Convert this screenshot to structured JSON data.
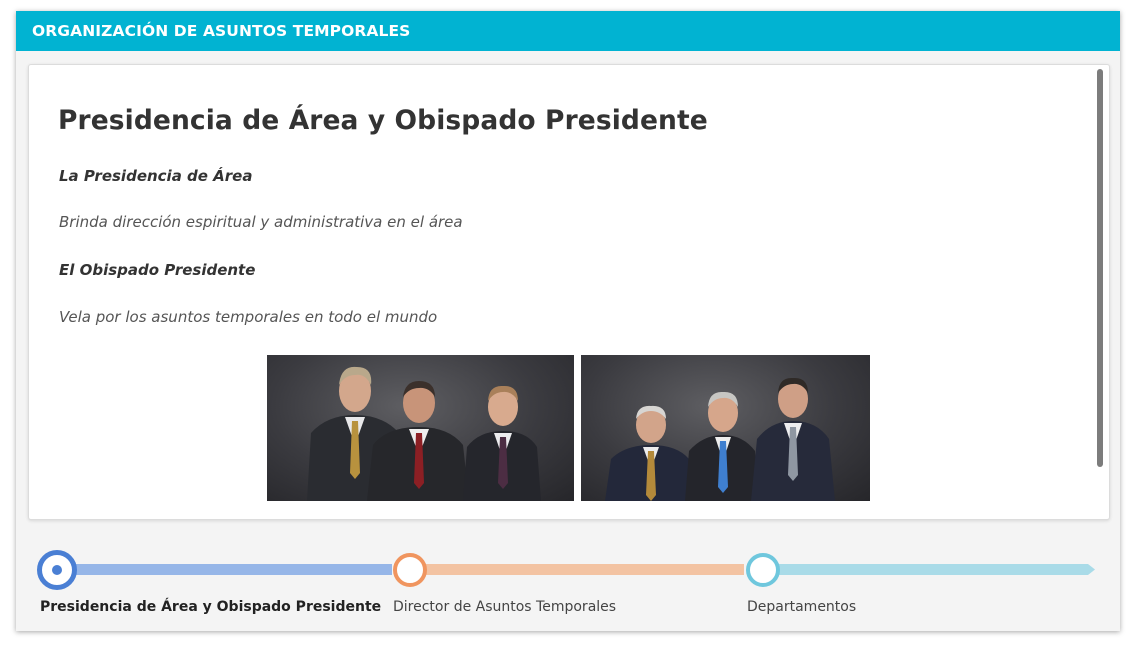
{
  "header": {
    "title": "ORGANIZACIÓN DE ASUNTOS TEMPORALES"
  },
  "content": {
    "title": "Presidencia de Área y Obispado Presidente",
    "sections": [
      {
        "heading": "La Presidencia de Área",
        "description": "Brinda dirección espiritual y administrativa en el área"
      },
      {
        "heading": "El Obispado Presidente",
        "description": "Vela por los asuntos temporales en todo el mundo"
      }
    ]
  },
  "timeline": {
    "steps": [
      {
        "label": "Presidencia de Área y Obispado Presidente",
        "state": "active",
        "color": "#4a7fd4",
        "bar_color": "#96b6e8"
      },
      {
        "label": "Director de Asuntos Temporales",
        "state": "inactive",
        "color": "#f0955f",
        "bar_color": "#f3c3a2"
      },
      {
        "label": "Departamentos",
        "state": "inactive",
        "color": "#6fc7dd",
        "bar_color": "#a9dbe8"
      }
    ]
  },
  "colors": {
    "header_bg": "#01b3d2",
    "active_step": "#4a7fd4",
    "second_step": "#f0955f",
    "third_step": "#6fc7dd"
  }
}
